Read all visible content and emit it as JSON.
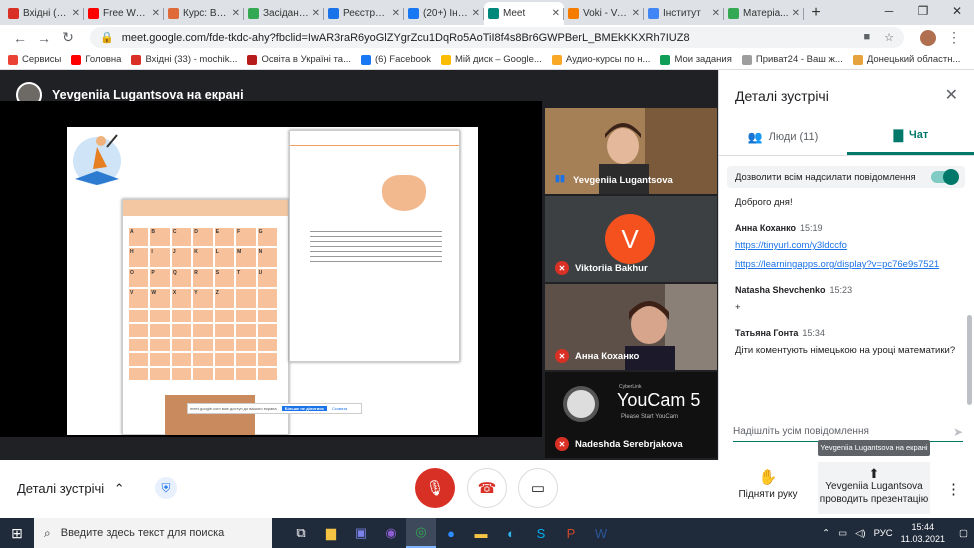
{
  "tabs": [
    {
      "label": "Вхідні (2...",
      "color": "#d93025"
    },
    {
      "label": "Free Web...",
      "color": "#ff0000"
    },
    {
      "label": "Курс: Ви...",
      "color": "#e06b3a"
    },
    {
      "label": "Засіданн...",
      "color": "#34a853"
    },
    {
      "label": "Реєстрац...",
      "color": "#1a73e8"
    },
    {
      "label": "(20+) Інш...",
      "color": "#1877f2"
    },
    {
      "label": "Meet",
      "color": "#00897b",
      "active": true
    },
    {
      "label": "Voki - Vo...",
      "color": "#f57c00"
    },
    {
      "label": "Інститут",
      "color": "#4285f4"
    },
    {
      "label": "Матеріа...",
      "color": "#34a853"
    }
  ],
  "address": {
    "url": "meet.google.com/fde-tkdc-ahy?fbclid=IwAR3raR6yoGlZYgrZcu1DqRo5AoTiI8f4s8Br6GWPBerL_BMEkKKXRh7IUZ8"
  },
  "bookmarks": [
    {
      "label": "Сервисы",
      "color": "#ea4335"
    },
    {
      "label": "Головна",
      "color": "#ff0000"
    },
    {
      "label": "Вхідні (33) - mochik...",
      "color": "#d93025"
    },
    {
      "label": "Освіта в Україні та...",
      "color": "#b71c1c"
    },
    {
      "label": "(6) Facebook",
      "color": "#1877f2"
    },
    {
      "label": "Мій диск – Google...",
      "color": "#fbbc04"
    },
    {
      "label": "Аудио-курсы по н...",
      "color": "#f9a825"
    },
    {
      "label": "Мои задания",
      "color": "#0f9d58"
    },
    {
      "label": "Приват24 - Ваш ж...",
      "color": "#9e9e9e"
    },
    {
      "label": "Донецький областн...",
      "color": "#e6a23c"
    }
  ],
  "meet": {
    "presenter_label": "Yevgeniia Lugantsova на екрані",
    "toast_text": "meet.google.com має доступ до вашого екрана",
    "toast_stop": "Більше не ділитися",
    "toast_hide": "Сховати"
  },
  "participants": [
    {
      "name": "Yevgeniia Lugantsova",
      "muted": false
    },
    {
      "name": "Viktoriia Bakhur",
      "muted": true,
      "initial": "V"
    },
    {
      "name": "Анна Коханко",
      "muted": true
    },
    {
      "name": "Nadeshda Serebrjakova",
      "muted": true,
      "overlay": "YouCam 5",
      "overlay_sub": "Please Start YouCam",
      "overlay_brand": "CyberLink"
    }
  ],
  "panel": {
    "title": "Деталі зустрічі",
    "tab_people": "Люди (11)",
    "tab_chat": "Чат",
    "allow_label": "Дозволити всім надсилати повідомлення",
    "messages": [
      {
        "sender": "",
        "time": "",
        "lines": [
          "Доброго дня!"
        ]
      },
      {
        "sender": "Анна Коханко",
        "time": "15:19",
        "links": [
          "https://tinyurl.com/y3ldccfo",
          "https://learningapps.org/display?v=pc76e9s7521"
        ]
      },
      {
        "sender": "Natasha Shevchenko",
        "time": "15:23",
        "lines": [
          "+"
        ]
      },
      {
        "sender": "Татьяна Гонта",
        "time": "15:34",
        "lines": [
          "Діти коментують німецькою на уроці математики?"
        ]
      }
    ],
    "input_placeholder": "Надішліть усім повідомлення"
  },
  "bottom": {
    "details_label": "Деталі зустрічі",
    "raise_hand": "Підняти руку",
    "present_line1": "Yevgeniia Lugantsova",
    "present_line2": "проводить презентацію",
    "tooltip": "Yevgeniia Lugantsova на екрані"
  },
  "taskbar": {
    "search_placeholder": "Введите здесь текст для поиска",
    "lang": "РУС",
    "time": "15:44",
    "date": "11.03.2021"
  },
  "worksheet": {
    "grid_letters": [
      "A",
      "B",
      "C",
      "D",
      "E",
      "F",
      "G",
      "H",
      "I",
      "J",
      "K",
      "L",
      "M",
      "N",
      "O",
      "P",
      "Q",
      "R",
      "S",
      "T",
      "U",
      "V",
      "W",
      "X",
      "Y",
      "Z",
      "",
      "",
      ""
    ]
  }
}
